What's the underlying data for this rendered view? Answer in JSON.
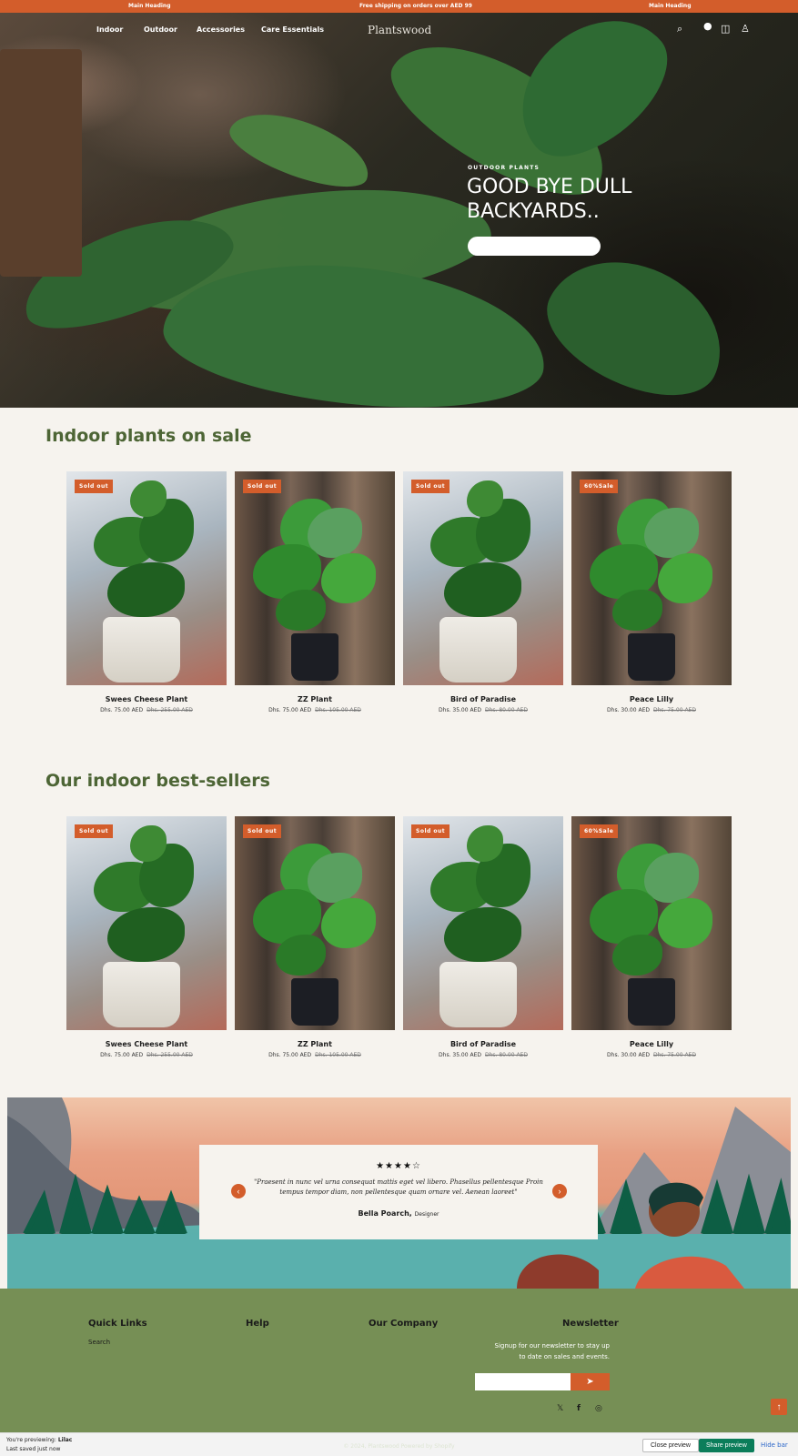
{
  "announcement": {
    "left": "Main Heading",
    "center": "Free shipping on orders over AED 99",
    "right": "Main Heading"
  },
  "header": {
    "nav": [
      "Indoor",
      "Outdoor",
      "Accessories",
      "Care Essentials"
    ],
    "logo": "Plantswood",
    "icons": [
      "search-icon",
      "user-icon",
      "cart-icon",
      "account-icon"
    ]
  },
  "hero": {
    "eyebrow": "OUTDOOR PLANTS",
    "title": "GOOD BYE DULL BACKYARDS.."
  },
  "sale_section": {
    "title": "Indoor plants on sale",
    "products": [
      {
        "badge": "Sold out",
        "name": "Swees Cheese Plant",
        "price": "Dhs. 75.00 AED",
        "compare": "Dhs. 255.00 AED"
      },
      {
        "badge": "Sold out",
        "name": "ZZ Plant",
        "price": "Dhs. 75.00 AED",
        "compare": "Dhs. 105.00 AED"
      },
      {
        "badge": "Sold out",
        "name": "Bird of Paradise",
        "price": "Dhs. 35.00 AED",
        "compare": "Dhs. 80.00 AED"
      },
      {
        "badge": "60%Sale",
        "name": "Peace Lilly",
        "price": "Dhs. 30.00 AED",
        "compare": "Dhs. 75.00 AED"
      }
    ]
  },
  "bestsellers_section": {
    "title": "Our indoor best-sellers",
    "products": [
      {
        "badge": "Sold out",
        "name": "Swees Cheese Plant",
        "price": "Dhs. 75.00 AED",
        "compare": "Dhs. 255.00 AED"
      },
      {
        "badge": "Sold out",
        "name": "ZZ Plant",
        "price": "Dhs. 75.00 AED",
        "compare": "Dhs. 105.00 AED"
      },
      {
        "badge": "Sold out",
        "name": "Bird of Paradise",
        "price": "Dhs. 35.00 AED",
        "compare": "Dhs. 80.00 AED"
      },
      {
        "badge": "60%Sale",
        "name": "Peace Lilly",
        "price": "Dhs. 30.00 AED",
        "compare": "Dhs. 75.00 AED"
      }
    ]
  },
  "testimonial": {
    "stars": "★★★★☆",
    "rating": 4,
    "quote": "\"Praesent in nunc vel urna consequat mattis eget vel libero. Phasellus pellentesque Proin tempus tempor diam, non pellentesque quam ornare vel. Aenean laoreet\"",
    "author": "Bella Poarch,",
    "role": "Designer",
    "prev": "‹",
    "next": "›"
  },
  "footer": {
    "quick_links_title": "Quick Links",
    "quick_links": [
      "Search"
    ],
    "help_title": "Help",
    "company_title": "Our Company",
    "newsletter_title": "Newsletter",
    "newsletter_text": "Signup for our newsletter to stay up to date on sales and events.",
    "email_placeholder": "",
    "submit_icon": "➤",
    "social": [
      "𝕏",
      "f",
      "◎"
    ],
    "back_to_top": "↑",
    "copyright": "© 2024, Plantswood Powered by Shopify"
  },
  "preview_bar": {
    "line1_prefix": "You're previewing:",
    "theme_name": "Lilac",
    "line2": "Last saved just now",
    "close_label": "Close preview",
    "share_label": "Share preview",
    "hide_label": "Hide bar"
  },
  "colors": {
    "accent": "#d35d2b",
    "heading_green": "#4d6535",
    "footer_green": "#768f55",
    "background": "#f6f3ee",
    "share_button": "#0b7d5a"
  }
}
